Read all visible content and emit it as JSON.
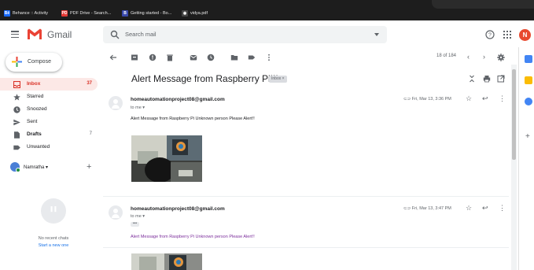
{
  "bookmarks": [
    {
      "label": "Behance :: Activity",
      "badge": "Bē",
      "color": "#1769ff"
    },
    {
      "label": "PDF Drive - Search...",
      "badge": "PD",
      "color": "#e53935"
    },
    {
      "label": "Getting started - Bo...",
      "badge": "B",
      "color": "#3949ab"
    },
    {
      "label": "vidya.pdf",
      "badge": "◉",
      "color": "#444444"
    }
  ],
  "app": {
    "name": "Gmail",
    "avatar_letter": "N"
  },
  "search": {
    "placeholder": "Search mail"
  },
  "compose_label": "Compose",
  "nav": [
    {
      "label": "Inbox",
      "count": "37",
      "icon": "inbox-icon"
    },
    {
      "label": "Starred",
      "count": "",
      "icon": "star-icon"
    },
    {
      "label": "Snoozed",
      "count": "",
      "icon": "clock-icon"
    },
    {
      "label": "Sent",
      "count": "",
      "icon": "send-icon"
    },
    {
      "label": "Drafts",
      "count": "7",
      "icon": "draft-icon"
    },
    {
      "label": "Unwanted",
      "count": "",
      "icon": "label-icon"
    }
  ],
  "user": {
    "name": "Namratha"
  },
  "chat": {
    "empty_text": "No recent chats",
    "start_link": "Start a new one"
  },
  "toolbar": {
    "pager_text": "18 of 184"
  },
  "thread": {
    "subject": "Alert Message from Raspberry Pi!!!",
    "tag": "Inbox"
  },
  "messages": [
    {
      "sender": "homeautomationproject08@gmail.com",
      "to": "to me",
      "date": "Fri, Mar 13, 3:36 PM",
      "body": "Alert Message from Raspberry Pi Unknown person Please Alert!!"
    },
    {
      "sender": "homeautomationproject08@gmail.com",
      "to": "to me",
      "date": "Fri, Mar 13, 3:47 PM",
      "body": "Alert Message from Raspberry Pi Unknown person Please Alert!!"
    }
  ],
  "colors": {
    "brand_red": "#d93025",
    "link_blue": "#1a73e8",
    "active_bg": "#fce8e6"
  }
}
